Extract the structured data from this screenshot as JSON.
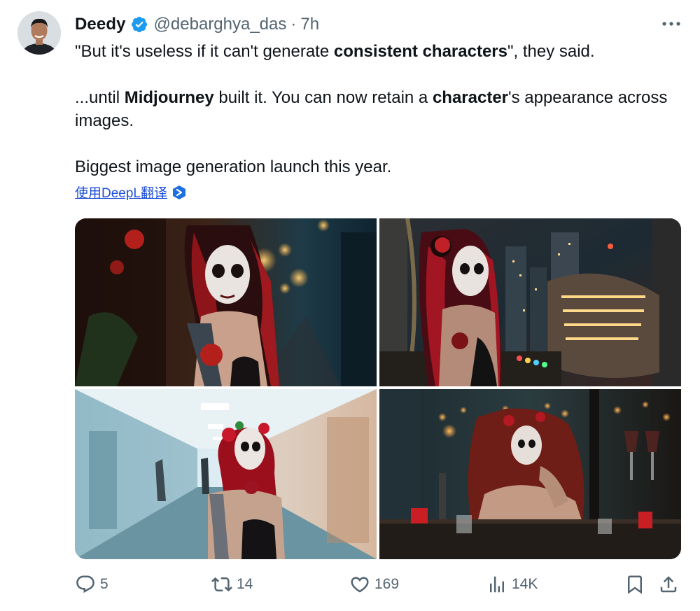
{
  "author": {
    "name": "Deedy",
    "handle": "@debarghya_das",
    "separator": "·",
    "time": "7h"
  },
  "tweet": {
    "line1": {
      "p1": "\"But it's useless if it can't generate ",
      "b1": "consistent characters",
      "p2": "\", they said."
    },
    "line2": {
      "p1": "...until ",
      "b1": "Midjourney",
      "p2": " built it. You can now retain a ",
      "b2": "character",
      "p3": "'s appearance across images."
    },
    "line3": "Biggest image generation launch this year."
  },
  "translate": {
    "label": "使用DeepL翻译"
  },
  "media": {
    "images": [
      {
        "name": "woman in skull makeup on neon alley"
      },
      {
        "name": "woman in skull makeup overlooking futuristic city"
      },
      {
        "name": "woman in skull makeup in hospital corridor"
      },
      {
        "name": "woman in skull makeup at bar"
      }
    ]
  },
  "actions": {
    "replies": "5",
    "retweets": "14",
    "likes": "169",
    "views": "14K"
  },
  "colors": {
    "verified": "#1d9bf0",
    "muted": "#536471",
    "link": "#1d4ed8"
  }
}
